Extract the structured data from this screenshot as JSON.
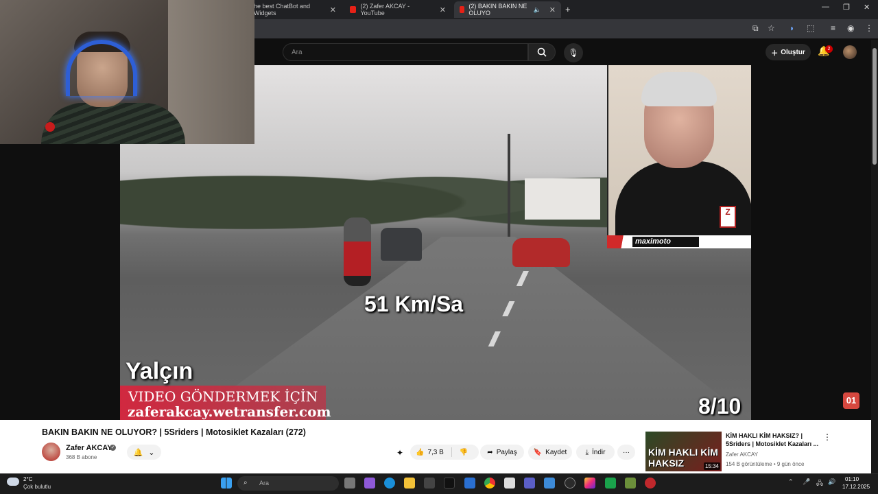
{
  "browser": {
    "tabs": [
      {
        "label": "he best ChatBot and Widgets",
        "active": false
      },
      {
        "label": "(2) Zafer AKCAY - YouTube",
        "active": false
      },
      {
        "label": "(2) BAKIN BAKIN NE OLUYO",
        "active": true
      }
    ],
    "new_tab": "+"
  },
  "youtube": {
    "search_placeholder": "Ara",
    "create_label": "Oluştur",
    "notification_count": "2"
  },
  "video": {
    "speed_text": "51 Km/Sa",
    "counter_text": "8/10",
    "name_caption": "Yalçın",
    "banner_line1": "VIDEO GÖNDERMEK İÇİN",
    "banner_line2": "zaferakcay.wetransfer.com",
    "pip_brand": "maximoto",
    "corner_logo": "01"
  },
  "info": {
    "title": "BAKIN BAKIN NE OLUYOR? | 5Sriders | Motosiklet Kazaları (272)",
    "channel_name": "Zafer AKCAY",
    "subscribers": "368 B abone",
    "likes": "7,3 B",
    "share_label": "Paylaş",
    "save_label": "Kaydet",
    "download_label": "İndir",
    "more_label": "···"
  },
  "recommended": {
    "title": "KİM HAKLI KİM HAKSIZ? | 5Sriders | Motosiklet Kazaları ...",
    "channel": "Zafer AKCAY",
    "meta": "154 B görüntüleme • 9 gün önce",
    "thumb_text": "KİM HAKLI KİM HAKSIZ",
    "duration": "15:34"
  },
  "taskbar": {
    "temperature": "2°C",
    "weather_desc": "Çok bulutlu",
    "search_placeholder": "Ara",
    "time": "01:10",
    "date": "17.12.2025"
  },
  "colors": {
    "youtube_red": "#e62117",
    "banner_red": "#d6253d",
    "page_bg": "#0f0f0f"
  }
}
